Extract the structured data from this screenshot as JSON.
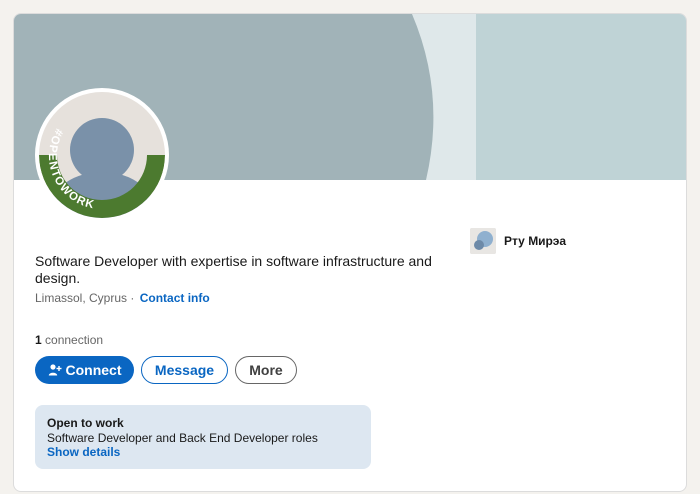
{
  "profile": {
    "headline": "Software Developer with expertise in software infrastructure and design.",
    "location": "Limassol, Cyprus",
    "separator": "·",
    "contact_info_label": "Contact info",
    "connections_count": "1",
    "connections_label": "connection",
    "avatar_badge_text": "#OPENTOWORK"
  },
  "actions": {
    "connect_label": "Connect",
    "message_label": "Message",
    "more_label": "More"
  },
  "open_to_work": {
    "title": "Open to work",
    "roles": "Software Developer and Back End Developer roles",
    "show_details_label": "Show details"
  },
  "organization": {
    "name": "Рту Мирэа"
  },
  "colors": {
    "accent": "#0a66c2",
    "open_to_work_green": "#4c7a2f",
    "banner_arc": "#a1b3b8",
    "banner_right": "#bfd3d6"
  }
}
